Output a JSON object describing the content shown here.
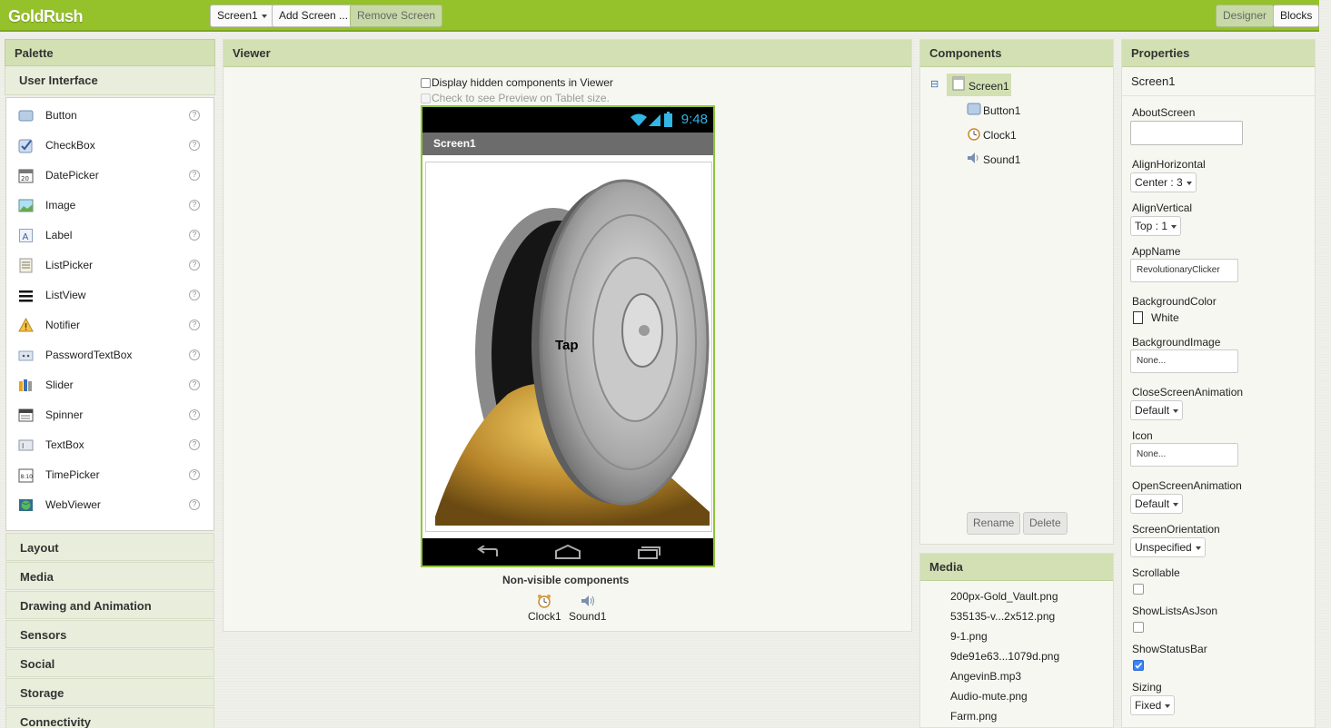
{
  "app": {
    "title": "GoldRush"
  },
  "toolbar": {
    "screen_select": "Screen1",
    "add_screen": "Add Screen ...",
    "remove_screen": "Remove Screen",
    "designer": "Designer",
    "blocks": "Blocks"
  },
  "palette": {
    "title": "Palette",
    "section": "User Interface",
    "items": [
      {
        "label": "Button",
        "icon": "button-icon"
      },
      {
        "label": "CheckBox",
        "icon": "checkbox-icon"
      },
      {
        "label": "DatePicker",
        "icon": "calendar-icon"
      },
      {
        "label": "Image",
        "icon": "image-icon"
      },
      {
        "label": "Label",
        "icon": "label-icon"
      },
      {
        "label": "ListPicker",
        "icon": "listpicker-icon"
      },
      {
        "label": "ListView",
        "icon": "listview-icon"
      },
      {
        "label": "Notifier",
        "icon": "warning-icon"
      },
      {
        "label": "PasswordTextBox",
        "icon": "password-icon"
      },
      {
        "label": "Slider",
        "icon": "slider-icon"
      },
      {
        "label": "Spinner",
        "icon": "spinner-icon"
      },
      {
        "label": "TextBox",
        "icon": "textbox-icon"
      },
      {
        "label": "TimePicker",
        "icon": "timepicker-icon"
      },
      {
        "label": "WebViewer",
        "icon": "globe-icon"
      }
    ],
    "help": "?",
    "categories": [
      "Layout",
      "Media",
      "Drawing and Animation",
      "Sensors",
      "Social",
      "Storage",
      "Connectivity"
    ]
  },
  "viewer": {
    "title": "Viewer",
    "hidden_label": "Display hidden components in Viewer",
    "tablet_label": "Check to see Preview on Tablet size.",
    "phone_time": "9:48",
    "screen_title": "Screen1",
    "button_text": "Tap",
    "nonvisible_title": "Non-visible components",
    "nonvisible": [
      "Clock1",
      "Sound1"
    ]
  },
  "components": {
    "title": "Components",
    "tree": [
      "Screen1",
      "Button1",
      "Clock1",
      "Sound1"
    ],
    "expander": "⊟",
    "rename": "Rename",
    "delete": "Delete"
  },
  "media": {
    "title": "Media",
    "files": [
      "200px-Gold_Vault.png",
      "535135-v...2x512.png",
      "9-1.png",
      "9de91e63...1079d.png",
      "AngevinB.mp3",
      "Audio-mute.png",
      "Farm.png"
    ]
  },
  "properties": {
    "title": "Properties",
    "component": "Screen1",
    "about_label": "AboutScreen",
    "about_value": "",
    "align_h_label": "AlignHorizontal",
    "align_h_value": "Center : 3",
    "align_v_label": "AlignVertical",
    "align_v_value": "Top : 1",
    "appname_label": "AppName",
    "appname_value": "RevolutionaryClicker",
    "bgcolor_label": "BackgroundColor",
    "bgcolor_value": "White",
    "bgimage_label": "BackgroundImage",
    "bgimage_value": "None...",
    "close_anim_label": "CloseScreenAnimation",
    "close_anim_value": "Default",
    "icon_label": "Icon",
    "icon_value": "None...",
    "open_anim_label": "OpenScreenAnimation",
    "open_anim_value": "Default",
    "orientation_label": "ScreenOrientation",
    "orientation_value": "Unspecified",
    "scrollable_label": "Scrollable",
    "showlists_label": "ShowListsAsJson",
    "statusbar_label": "ShowStatusBar",
    "sizing_label": "Sizing",
    "sizing_value": "Fixed"
  }
}
